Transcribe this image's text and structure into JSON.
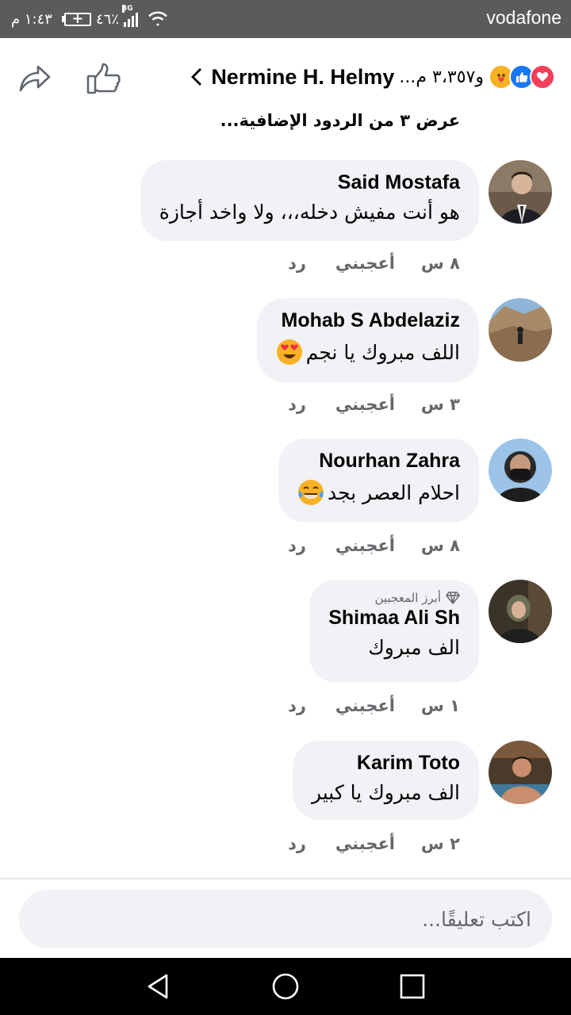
{
  "status_bar": {
    "carrier": "vodafone",
    "time": "١:٤٣ م",
    "battery_percent": "٤٦٪",
    "network": "3G"
  },
  "header": {
    "post_author": "Nermine H. Helmy",
    "reaction_summary": "و٣،٣٥٧ م...",
    "reactions": [
      "care",
      "like",
      "love"
    ]
  },
  "view_more_replies": "عرض ٣ من الردود الإضافية...",
  "comments": [
    {
      "name": "Said Mostafa",
      "text": "هو أنت مفيش دخله،،، ولا واخد أجازة",
      "time": "٨ س",
      "like_label": "أعجبني",
      "reply_label": "رد",
      "badge": ""
    },
    {
      "name": "Mohab S Abdelaziz",
      "text": "اللف مبروك يا نجم",
      "emoji": "heart-eyes",
      "time": "٣ س",
      "like_label": "أعجبني",
      "reply_label": "رد",
      "badge": ""
    },
    {
      "name": "Nourhan Zahra",
      "text": "احلام العصر بجد",
      "emoji": "tears-of-joy",
      "time": "٨ س",
      "like_label": "أعجبني",
      "reply_label": "رد",
      "badge": ""
    },
    {
      "name": "Shimaa Ali Sh",
      "text": "الف مبروك",
      "time": "١ س",
      "like_label": "أعجبني",
      "reply_label": "رد",
      "badge": "أبرز المعجبين"
    },
    {
      "name": "Karim Toto",
      "text": "الف مبروك يا كبير",
      "time": "٢ س",
      "like_label": "أعجبني",
      "reply_label": "رد",
      "badge": ""
    }
  ],
  "composer": {
    "placeholder": "اكتب تعليقًا..."
  },
  "colors": {
    "bubble": "#f0f2f5",
    "meta_text": "#65676b",
    "like_blue": "#1877f2",
    "love_red": "#f33e58",
    "status_bar": "#5b5b5b"
  }
}
